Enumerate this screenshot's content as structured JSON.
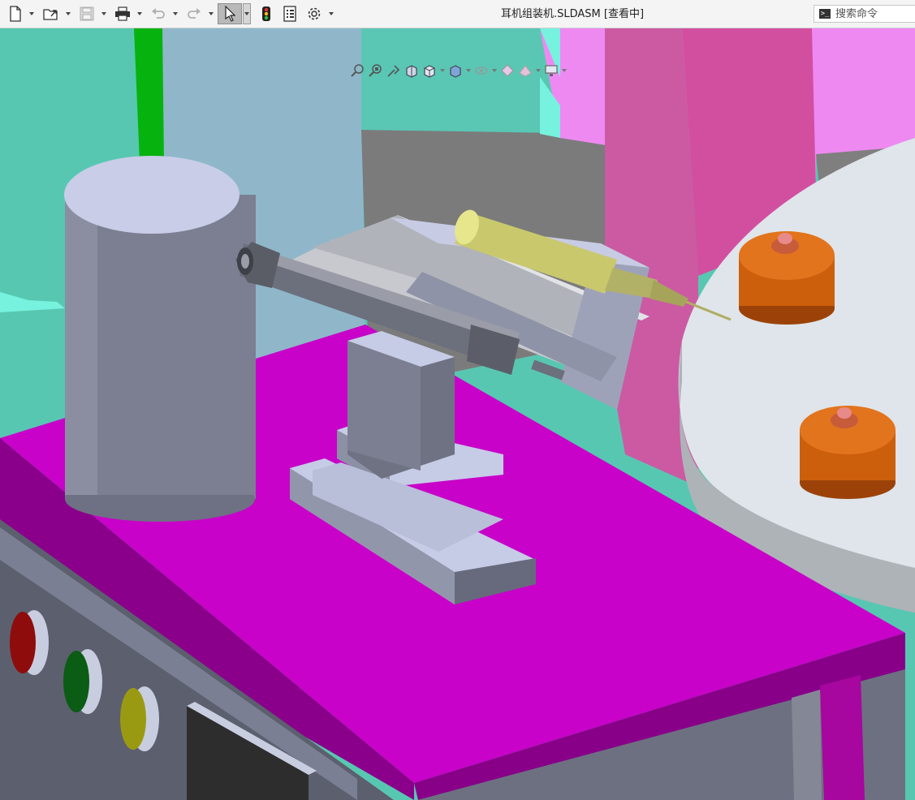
{
  "window": {
    "title": "耳机组装机.SLDASM [查看中]"
  },
  "search": {
    "placeholder": "搜索命令"
  },
  "icons": {
    "toolbar": [
      "new-document-icon",
      "open-folder-icon",
      "save-icon",
      "print-icon",
      "undo-icon",
      "redo-icon",
      "select-pointer-icon",
      "traffic-light-icon",
      "file-properties-icon",
      "gear-icon"
    ],
    "heads_up": [
      "zoom-to-fit-icon",
      "zoom-to-area-icon",
      "previous-view-icon",
      "section-view-icon",
      "view-orientation-icon",
      "display-style-icon",
      "hide-show-items-icon",
      "edit-appearance-icon",
      "apply-scene-icon",
      "view-settings-icon"
    ]
  },
  "colors": {
    "magenta_table": "#c802c8",
    "orange_cup": "#cc5f0b",
    "teal_wall": "#5ec8b2",
    "pink_wall": "#ef8bf4",
    "gray_part": "#7c7f91",
    "syringe_yellow": "#c9c86d",
    "button_red": "#8e0c0c",
    "button_green": "#0b5c15",
    "button_yellow": "#9a9a12"
  }
}
